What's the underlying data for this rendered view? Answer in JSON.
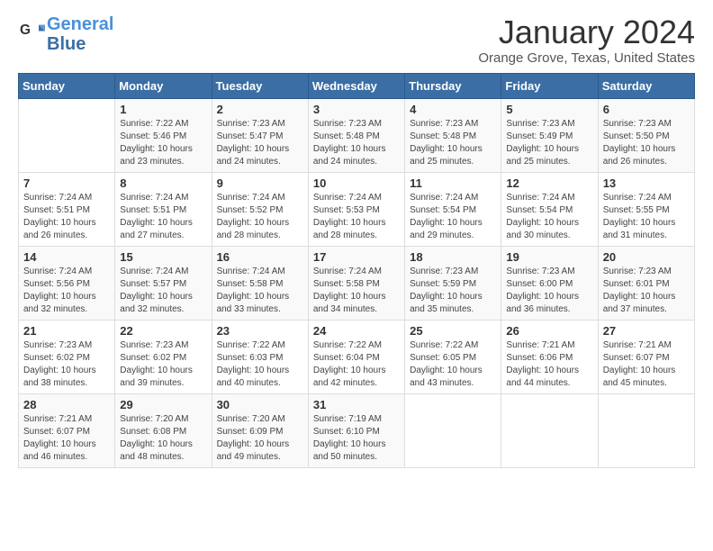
{
  "header": {
    "logo_line1": "General",
    "logo_line2": "Blue",
    "title": "January 2024",
    "subtitle": "Orange Grove, Texas, United States"
  },
  "weekdays": [
    "Sunday",
    "Monday",
    "Tuesday",
    "Wednesday",
    "Thursday",
    "Friday",
    "Saturday"
  ],
  "weeks": [
    [
      {
        "day": "",
        "sunrise": "",
        "sunset": "",
        "daylight": ""
      },
      {
        "day": "1",
        "sunrise": "7:22 AM",
        "sunset": "5:46 PM",
        "daylight": "10 hours and 23 minutes."
      },
      {
        "day": "2",
        "sunrise": "7:23 AM",
        "sunset": "5:47 PM",
        "daylight": "10 hours and 24 minutes."
      },
      {
        "day": "3",
        "sunrise": "7:23 AM",
        "sunset": "5:48 PM",
        "daylight": "10 hours and 24 minutes."
      },
      {
        "day": "4",
        "sunrise": "7:23 AM",
        "sunset": "5:48 PM",
        "daylight": "10 hours and 25 minutes."
      },
      {
        "day": "5",
        "sunrise": "7:23 AM",
        "sunset": "5:49 PM",
        "daylight": "10 hours and 25 minutes."
      },
      {
        "day": "6",
        "sunrise": "7:23 AM",
        "sunset": "5:50 PM",
        "daylight": "10 hours and 26 minutes."
      }
    ],
    [
      {
        "day": "7",
        "sunrise": "7:24 AM",
        "sunset": "5:51 PM",
        "daylight": "10 hours and 26 minutes."
      },
      {
        "day": "8",
        "sunrise": "7:24 AM",
        "sunset": "5:51 PM",
        "daylight": "10 hours and 27 minutes."
      },
      {
        "day": "9",
        "sunrise": "7:24 AM",
        "sunset": "5:52 PM",
        "daylight": "10 hours and 28 minutes."
      },
      {
        "day": "10",
        "sunrise": "7:24 AM",
        "sunset": "5:53 PM",
        "daylight": "10 hours and 28 minutes."
      },
      {
        "day": "11",
        "sunrise": "7:24 AM",
        "sunset": "5:54 PM",
        "daylight": "10 hours and 29 minutes."
      },
      {
        "day": "12",
        "sunrise": "7:24 AM",
        "sunset": "5:54 PM",
        "daylight": "10 hours and 30 minutes."
      },
      {
        "day": "13",
        "sunrise": "7:24 AM",
        "sunset": "5:55 PM",
        "daylight": "10 hours and 31 minutes."
      }
    ],
    [
      {
        "day": "14",
        "sunrise": "7:24 AM",
        "sunset": "5:56 PM",
        "daylight": "10 hours and 32 minutes."
      },
      {
        "day": "15",
        "sunrise": "7:24 AM",
        "sunset": "5:57 PM",
        "daylight": "10 hours and 32 minutes."
      },
      {
        "day": "16",
        "sunrise": "7:24 AM",
        "sunset": "5:58 PM",
        "daylight": "10 hours and 33 minutes."
      },
      {
        "day": "17",
        "sunrise": "7:24 AM",
        "sunset": "5:58 PM",
        "daylight": "10 hours and 34 minutes."
      },
      {
        "day": "18",
        "sunrise": "7:23 AM",
        "sunset": "5:59 PM",
        "daylight": "10 hours and 35 minutes."
      },
      {
        "day": "19",
        "sunrise": "7:23 AM",
        "sunset": "6:00 PM",
        "daylight": "10 hours and 36 minutes."
      },
      {
        "day": "20",
        "sunrise": "7:23 AM",
        "sunset": "6:01 PM",
        "daylight": "10 hours and 37 minutes."
      }
    ],
    [
      {
        "day": "21",
        "sunrise": "7:23 AM",
        "sunset": "6:02 PM",
        "daylight": "10 hours and 38 minutes."
      },
      {
        "day": "22",
        "sunrise": "7:23 AM",
        "sunset": "6:02 PM",
        "daylight": "10 hours and 39 minutes."
      },
      {
        "day": "23",
        "sunrise": "7:22 AM",
        "sunset": "6:03 PM",
        "daylight": "10 hours and 40 minutes."
      },
      {
        "day": "24",
        "sunrise": "7:22 AM",
        "sunset": "6:04 PM",
        "daylight": "10 hours and 42 minutes."
      },
      {
        "day": "25",
        "sunrise": "7:22 AM",
        "sunset": "6:05 PM",
        "daylight": "10 hours and 43 minutes."
      },
      {
        "day": "26",
        "sunrise": "7:21 AM",
        "sunset": "6:06 PM",
        "daylight": "10 hours and 44 minutes."
      },
      {
        "day": "27",
        "sunrise": "7:21 AM",
        "sunset": "6:07 PM",
        "daylight": "10 hours and 45 minutes."
      }
    ],
    [
      {
        "day": "28",
        "sunrise": "7:21 AM",
        "sunset": "6:07 PM",
        "daylight": "10 hours and 46 minutes."
      },
      {
        "day": "29",
        "sunrise": "7:20 AM",
        "sunset": "6:08 PM",
        "daylight": "10 hours and 48 minutes."
      },
      {
        "day": "30",
        "sunrise": "7:20 AM",
        "sunset": "6:09 PM",
        "daylight": "10 hours and 49 minutes."
      },
      {
        "day": "31",
        "sunrise": "7:19 AM",
        "sunset": "6:10 PM",
        "daylight": "10 hours and 50 minutes."
      },
      {
        "day": "",
        "sunrise": "",
        "sunset": "",
        "daylight": ""
      },
      {
        "day": "",
        "sunrise": "",
        "sunset": "",
        "daylight": ""
      },
      {
        "day": "",
        "sunrise": "",
        "sunset": "",
        "daylight": ""
      }
    ]
  ]
}
